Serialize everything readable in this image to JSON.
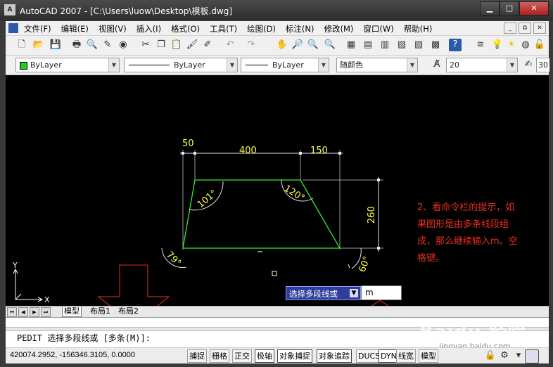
{
  "window": {
    "app_icon_text": "A",
    "title": "AutoCAD 2007 - [C:\\Users\\luow\\Desktop\\模板.dwg]",
    "btn_min": "▁",
    "btn_max": "□",
    "btn_close": "✕"
  },
  "menu": {
    "items": [
      "文件(F)",
      "编辑(E)",
      "视图(V)",
      "插入(I)",
      "格式(O)",
      "工具(T)",
      "绘图(D)",
      "标注(N)",
      "修改(M)",
      "窗口(W)",
      "帮助(H)"
    ],
    "mdi_min": "_",
    "mdi_restore": "⧉",
    "mdi_close": "✕"
  },
  "properties": {
    "layer": "ByLayer",
    "linetype": "ByLayer",
    "lineweight": "ByLayer",
    "color": "随颜色",
    "text_height": "20",
    "right_value": "30"
  },
  "drawing": {
    "dim_top_left": "50",
    "dim_top_mid": "400",
    "dim_top_right": "150",
    "dim_height": "260",
    "angle_top_left": "101°",
    "angle_top_right": "120°",
    "angle_bottom_left": "79°",
    "angle_bottom_right": "60°",
    "ucs_y": "Y",
    "ucs_x": "X",
    "line_color": "#33ee33",
    "dim_color": "#ffff4a",
    "arrow_color": "#e83020"
  },
  "tabs": [
    "模型",
    "布局1",
    "布局2"
  ],
  "command": {
    "line": "PEDIT 选择多段线或 [多条(M)]:"
  },
  "dyn_input": {
    "prompt": "选择多段线或",
    "value": "m"
  },
  "annotation": {
    "text": "2、看命令栏的提示，如果图形是由多条线段组成，那么继续输入m。空格键。"
  },
  "status": {
    "coords": "420074.2952, -156346.3105, 0.0000",
    "buttons": [
      "捕捉",
      "栅格",
      "正交",
      "极轴",
      "对象捕捉",
      "对象追踪",
      "DUCS",
      "DYN",
      "线宽",
      "模型"
    ]
  },
  "watermark": {
    "brand": "Baidu 经验",
    "url": "jingyan.baidu.com"
  }
}
